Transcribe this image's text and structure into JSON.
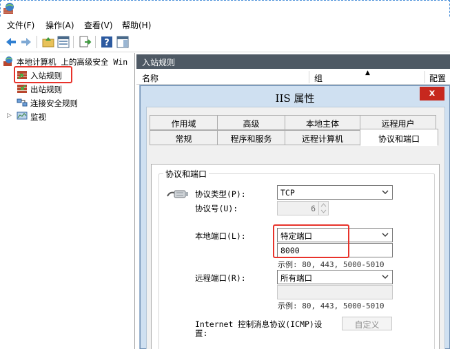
{
  "menu": {
    "file": "文件(F)",
    "action": "操作(A)",
    "view": "查看(V)",
    "help": "帮助(H)"
  },
  "tree": {
    "root": "本地计算机 上的高级安全 Win",
    "inbound": "入站规则",
    "outbound": "出站规则",
    "connection_security": "连接安全规则",
    "monitor": "监视"
  },
  "pane": {
    "header": "入站规则",
    "col_name": "名称",
    "col_group": "组",
    "col_profile": "配置"
  },
  "dialog": {
    "title": "IIS 属性",
    "close": "x",
    "tabs_row1": [
      "作用域",
      "高级",
      "本地主体",
      "远程用户"
    ],
    "tabs_row2": [
      "常规",
      "程序和服务",
      "远程计算机",
      "协议和端口"
    ],
    "active_tab": "协议和端口",
    "group_title": "协议和端口",
    "protocol_type_label": "协议类型(P):",
    "protocol_type_value": "TCP",
    "protocol_number_label": "协议号(U):",
    "protocol_number_value": "6",
    "local_port_label": "本地端口(L):",
    "local_port_type": "特定端口",
    "local_port_value": "8000",
    "local_port_hint": "示例: 80, 443, 5000-5010",
    "remote_port_label": "远程端口(R):",
    "remote_port_type": "所有端口",
    "remote_port_value": "",
    "remote_port_hint": "示例: 80, 443, 5000-5010",
    "icmp_label_line1": "Internet 控制消息协议(ICMP)设",
    "icmp_label_line2": "置:",
    "customize_button": "自定义"
  },
  "colors": {
    "highlight": "#e8322a",
    "pane_header": "#4e5964",
    "dialog_frame": "#cfe0f1",
    "close_button": "#c7281e"
  },
  "icons": [
    "firewall-icon",
    "back-icon",
    "forward-icon",
    "up-folder-icon",
    "properties-icon",
    "export-icon",
    "help-icon",
    "show-pane-icon",
    "inbound-rules-icon",
    "outbound-rules-icon",
    "connection-security-icon",
    "monitor-icon",
    "network-cable-icon"
  ]
}
